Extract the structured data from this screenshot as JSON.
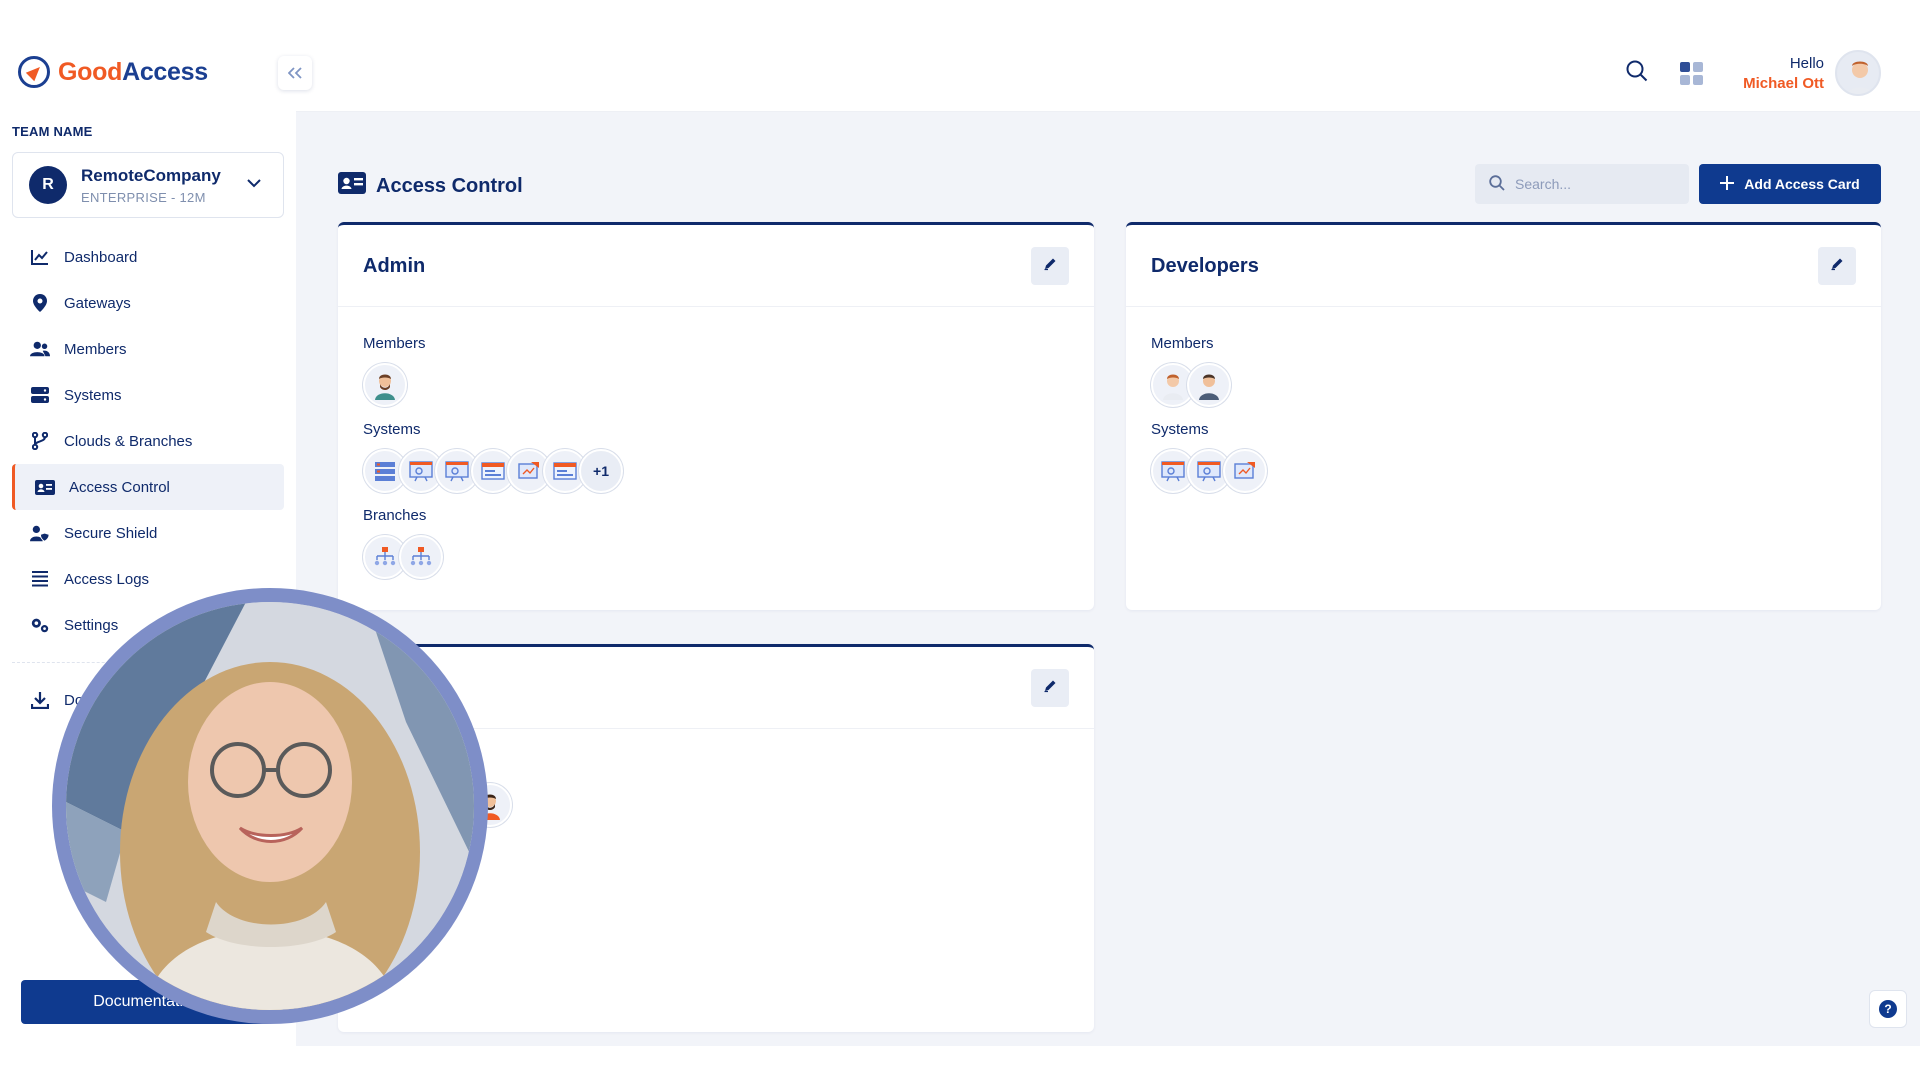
{
  "brand": {
    "name_part1": "Good",
    "name_part2": "Access"
  },
  "sidebar": {
    "team_label": "TEAM NAME",
    "team": {
      "initial": "R",
      "name": "RemoteCompany",
      "plan": "ENTERPRISE - 12M"
    },
    "items": [
      {
        "label": "Dashboard",
        "icon": "chart-line-icon"
      },
      {
        "label": "Gateways",
        "icon": "map-pin-icon"
      },
      {
        "label": "Members",
        "icon": "users-icon"
      },
      {
        "label": "Systems",
        "icon": "server-icon"
      },
      {
        "label": "Clouds & Branches",
        "icon": "branch-icon"
      },
      {
        "label": "Access Control",
        "icon": "id-card-icon",
        "active": true
      },
      {
        "label": "Secure Shield",
        "icon": "user-shield-icon"
      },
      {
        "label": "Access Logs",
        "icon": "list-icon"
      },
      {
        "label": "Settings",
        "icon": "gears-icon"
      }
    ],
    "download_label": "Dow",
    "documentation_label": "Documentation"
  },
  "header": {
    "hello": "Hello",
    "user_name": "Michael Ott"
  },
  "page": {
    "title": "Access Control",
    "search_placeholder": "Search...",
    "add_button": "Add Access Card"
  },
  "cards": [
    {
      "title": "Admin",
      "sections": [
        {
          "label": "Members",
          "count": 1
        },
        {
          "label": "Systems",
          "count": 6,
          "more": "+1"
        },
        {
          "label": "Branches",
          "count": 2
        }
      ]
    },
    {
      "title": "Developers",
      "sections": [
        {
          "label": "Members",
          "count": 2
        },
        {
          "label": "Systems",
          "count": 3
        }
      ]
    },
    {
      "title": ""
    }
  ],
  "colors": {
    "primary": "#0f2a6b",
    "accent": "#f05a24",
    "background": "#f2f4f9",
    "button": "#0f3a8f"
  }
}
